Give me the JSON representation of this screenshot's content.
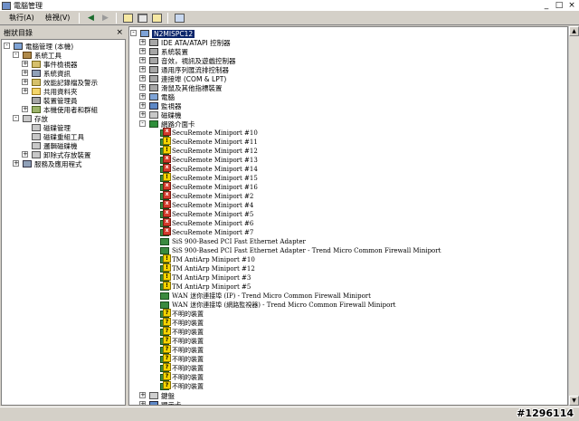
{
  "window": {
    "title": "電腦管理",
    "min_label": "_",
    "max_label": "□",
    "close_label": "×"
  },
  "menu": {
    "action": "執行(A)",
    "view": "檢視(V)"
  },
  "tabbar": {
    "label": "樹狀目錄",
    "close": "×"
  },
  "left_tree": [
    {
      "label": "電腦管理 (本機)",
      "indent": 0,
      "icon": "pc",
      "exp": "-"
    },
    {
      "label": "系統工具",
      "indent": 1,
      "icon": "tool",
      "exp": "-"
    },
    {
      "label": "事件檢視器",
      "indent": 2,
      "icon": "log",
      "exp": "+"
    },
    {
      "label": "系統資訊",
      "indent": 2,
      "icon": "svc",
      "exp": "+"
    },
    {
      "label": "效能記錄檔及警示",
      "indent": 2,
      "icon": "log",
      "exp": "+"
    },
    {
      "label": "共用資料夾",
      "indent": 2,
      "icon": "folder",
      "exp": "+"
    },
    {
      "label": "裝置管理員",
      "indent": 2,
      "icon": "dev",
      "exp": ""
    },
    {
      "label": "本機使用者和群組",
      "indent": 2,
      "icon": "user",
      "exp": "+"
    },
    {
      "label": "存放",
      "indent": 1,
      "icon": "disk",
      "exp": "-"
    },
    {
      "label": "磁碟管理",
      "indent": 2,
      "icon": "disk",
      "exp": ""
    },
    {
      "label": "磁碟重組工具",
      "indent": 2,
      "icon": "disk",
      "exp": ""
    },
    {
      "label": "邏輯磁碟機",
      "indent": 2,
      "icon": "disk",
      "exp": ""
    },
    {
      "label": "卸除式存放裝置",
      "indent": 2,
      "icon": "disk",
      "exp": "+"
    },
    {
      "label": "服務及應用程式",
      "indent": 1,
      "icon": "svc",
      "exp": "+"
    }
  ],
  "right_tree": {
    "root": "N2MISPC12",
    "categories": [
      {
        "label": "IDE ATA/ATAPI 控制器",
        "icon": "dev",
        "exp": "+"
      },
      {
        "label": "系統裝置",
        "icon": "dev",
        "exp": "+"
      },
      {
        "label": "音效，視訊及遊戲控制器",
        "icon": "dev",
        "exp": "+"
      },
      {
        "label": "通用序列匯流排控制器",
        "icon": "dev",
        "exp": "+"
      },
      {
        "label": "連接埠 (COM & LPT)",
        "icon": "dev",
        "exp": "+"
      },
      {
        "label": "滑鼠及其他指標裝置",
        "icon": "dev",
        "exp": "+"
      },
      {
        "label": "電腦",
        "icon": "pc",
        "exp": "+"
      },
      {
        "label": "監視器",
        "icon": "disp",
        "exp": "+"
      },
      {
        "label": "磁碟機",
        "icon": "disk",
        "exp": "+"
      },
      {
        "label": "網路介面卡",
        "icon": "net",
        "exp": "-"
      }
    ],
    "adapters": [
      {
        "label": "SecuRemote Miniport #10",
        "status": "err"
      },
      {
        "label": "SecuRemote Miniport #11",
        "status": "warn"
      },
      {
        "label": "SecuRemote Miniport #12",
        "status": "warn"
      },
      {
        "label": "SecuRemote Miniport #13",
        "status": "err"
      },
      {
        "label": "SecuRemote Miniport #14",
        "status": "err"
      },
      {
        "label": "SecuRemote Miniport #15",
        "status": "warn"
      },
      {
        "label": "SecuRemote Miniport #16",
        "status": "err"
      },
      {
        "label": "SecuRemote Miniport #2",
        "status": "err"
      },
      {
        "label": "SecuRemote Miniport #4",
        "status": "err"
      },
      {
        "label": "SecuRemote Miniport #5",
        "status": "err"
      },
      {
        "label": "SecuRemote Miniport #6",
        "status": "err"
      },
      {
        "label": "SecuRemote Miniport #7",
        "status": "err"
      },
      {
        "label": "SiS 900-Based PCI Fast Ethernet Adapter",
        "status": "ok"
      },
      {
        "label": "SiS 900-Based PCI Fast Ethernet Adapter - Trend Micro Common Firewall Miniport",
        "status": "ok"
      },
      {
        "label": "TM AntiArp Miniport #10",
        "status": "warn"
      },
      {
        "label": "TM AntiArp Miniport #12",
        "status": "warn"
      },
      {
        "label": "TM AntiArp Miniport #3",
        "status": "warn"
      },
      {
        "label": "TM AntiArp Miniport #5",
        "status": "warn"
      },
      {
        "label": "WAN 迷你連接埠 (IP) - Trend Micro Common Firewall Miniport",
        "status": "ok"
      },
      {
        "label": "WAN 迷你連接埠 (網路監視器) - Trend Micro Common Firewall Miniport",
        "status": "ok"
      },
      {
        "label": "不明的裝置",
        "status": "unk"
      },
      {
        "label": "不明的裝置",
        "status": "unk"
      },
      {
        "label": "不明的裝置",
        "status": "unk"
      },
      {
        "label": "不明的裝置",
        "status": "unk"
      },
      {
        "label": "不明的裝置",
        "status": "unk"
      },
      {
        "label": "不明的裝置",
        "status": "unk"
      },
      {
        "label": "不明的裝置",
        "status": "unk"
      },
      {
        "label": "不明的裝置",
        "status": "unk"
      },
      {
        "label": "不明的裝置",
        "status": "unk"
      }
    ],
    "tail": [
      {
        "label": "鍵盤",
        "icon": "kbd",
        "exp": "+"
      },
      {
        "label": "顯示卡",
        "icon": "disp",
        "exp": "+"
      }
    ]
  },
  "watermark": "#1296114"
}
